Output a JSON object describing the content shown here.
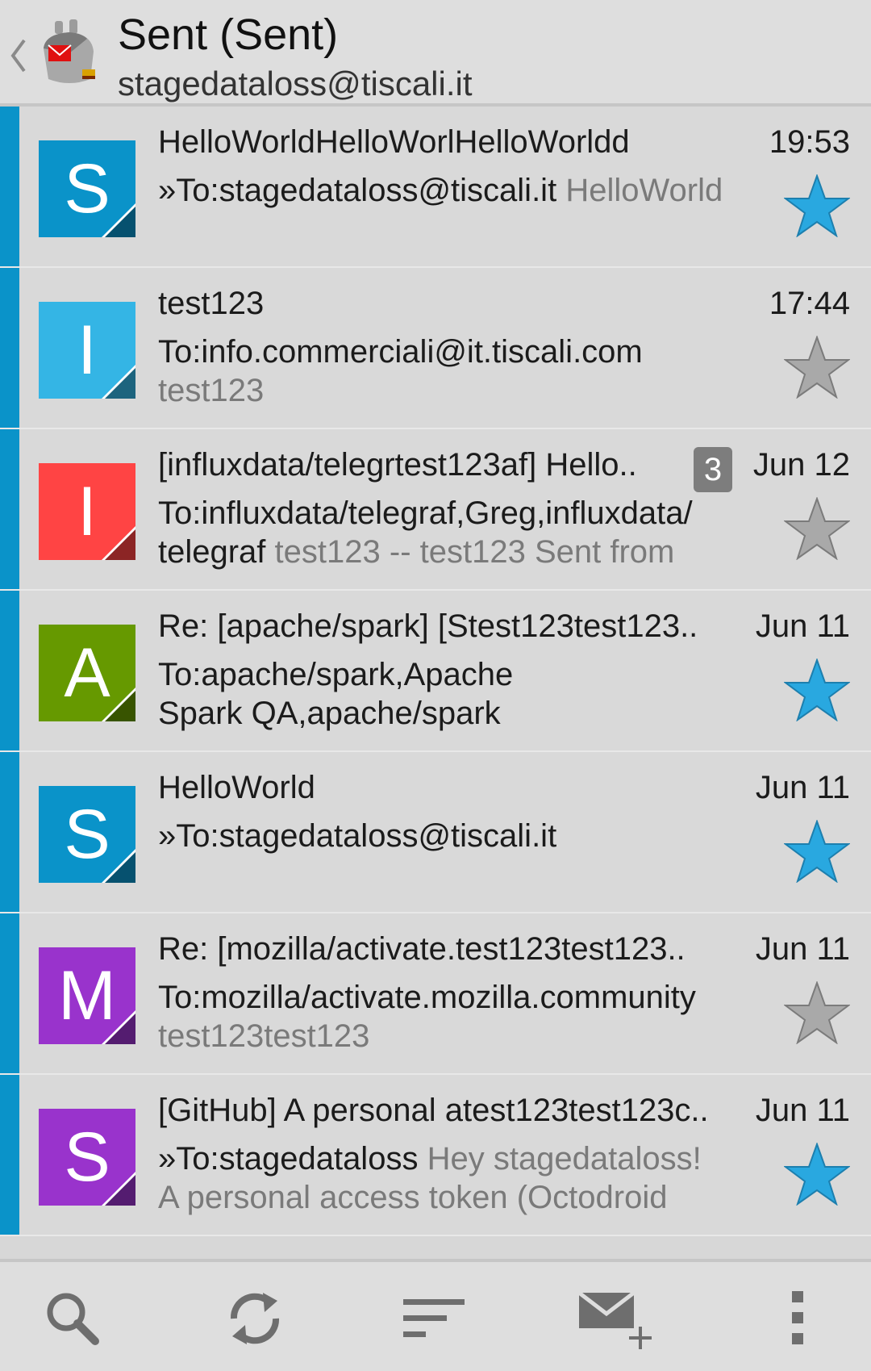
{
  "header": {
    "title": "Sent (Sent)",
    "account": "stagedataloss@tiscali.it"
  },
  "colors": {
    "accent": "#0a93c9",
    "star_active": "#29a8e0",
    "star_inactive": "#a9a9a9"
  },
  "messages": [
    {
      "avatar_letter": "S",
      "avatar_color": "#0a93c9",
      "subject": "HelloWorldHelloWorlHelloWorldd",
      "time": "19:53",
      "line2_dark": "»To:stagedataloss@tiscali.it",
      "line2_gray": "HelloWorld",
      "line3_dark": "",
      "line3_gray": "",
      "starred": true,
      "thread_count": ""
    },
    {
      "avatar_letter": "I",
      "avatar_color": "#34b5e5",
      "subject": "test123",
      "time": "17:44",
      "line2_dark": "To:info.commerciali@it.tiscali.com",
      "line2_gray": "",
      "line3_dark": "",
      "line3_gray": "test123",
      "starred": false,
      "thread_count": ""
    },
    {
      "avatar_letter": "I",
      "avatar_color": "#ff4444",
      "subject": "[influxdata/telegrtest123af] Hello..",
      "time": "Jun 12",
      "line2_dark": "To:influxdata/telegraf,Greg,influxdata/",
      "line2_gray": "",
      "line3_dark": "telegraf",
      "line3_gray": "test123 -- test123 Sent from",
      "starred": false,
      "thread_count": "3"
    },
    {
      "avatar_letter": "A",
      "avatar_color": "#669900",
      "subject": "Re: [apache/spark] [Stest123test123..",
      "time": "Jun 11",
      "line2_dark": "To:apache/spark,Apache",
      "line2_gray": "",
      "line3_dark": "Spark QA,apache/spark",
      "line3_gray": "",
      "starred": true,
      "thread_count": ""
    },
    {
      "avatar_letter": "S",
      "avatar_color": "#0a93c9",
      "subject": "HelloWorld",
      "time": "Jun 11",
      "line2_dark": "»To:stagedataloss@tiscali.it",
      "line2_gray": "",
      "line3_dark": "",
      "line3_gray": "",
      "starred": true,
      "thread_count": ""
    },
    {
      "avatar_letter": "M",
      "avatar_color": "#9933cc",
      "subject": "Re: [mozilla/activate.test123test123..",
      "time": "Jun 11",
      "line2_dark": "To:mozilla/activate.mozilla.community",
      "line2_gray": "",
      "line3_dark": "",
      "line3_gray": "test123test123",
      "starred": false,
      "thread_count": ""
    },
    {
      "avatar_letter": "S",
      "avatar_color": "#9933cc",
      "subject": "[GitHub] A personal atest123test123c..",
      "time": "Jun 11",
      "line2_dark": "»To:stagedataloss",
      "line2_gray": "Hey stagedataloss!",
      "line3_dark": "",
      "line3_gray": "A personal access token (Octodroid",
      "starred": true,
      "thread_count": ""
    }
  ],
  "bottom_bar": [
    {
      "icon": "search-icon"
    },
    {
      "icon": "refresh-icon"
    },
    {
      "icon": "sort-icon"
    },
    {
      "icon": "compose-icon"
    },
    {
      "icon": "overflow-menu-icon"
    }
  ]
}
